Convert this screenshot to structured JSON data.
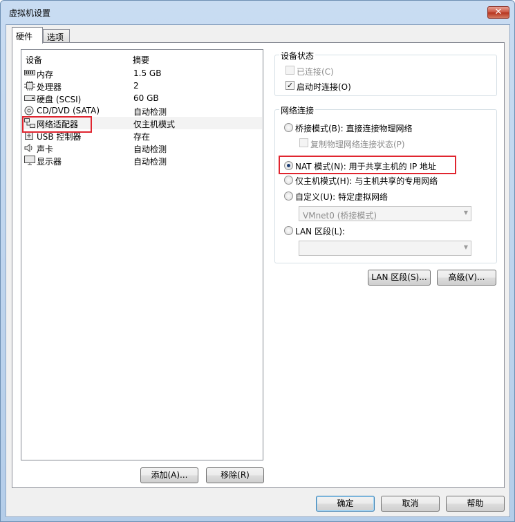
{
  "window": {
    "title": "虚拟机设置",
    "close_label": "✕"
  },
  "tabs": [
    {
      "label": "硬件"
    },
    {
      "label": "选项"
    }
  ],
  "device_list": {
    "columns": {
      "device": "设备",
      "summary": "摘要"
    },
    "rows": [
      {
        "name": "内存",
        "summary": "1.5 GB",
        "icon": "memory-icon"
      },
      {
        "name": "处理器",
        "summary": "2",
        "icon": "processor-icon"
      },
      {
        "name": "硬盘 (SCSI)",
        "summary": "60 GB",
        "icon": "hard-disk-icon"
      },
      {
        "name": "CD/DVD (SATA)",
        "summary": "自动检测",
        "icon": "cd-dvd-icon"
      },
      {
        "name": "网络适配器",
        "summary": "仅主机模式",
        "icon": "network-adapter-icon",
        "selected": true
      },
      {
        "name": "USB 控制器",
        "summary": "存在",
        "icon": "usb-icon"
      },
      {
        "name": "声卡",
        "summary": "自动检测",
        "icon": "sound-card-icon"
      },
      {
        "name": "显示器",
        "summary": "自动检测",
        "icon": "display-icon"
      }
    ],
    "add_label": "添加(A)...",
    "remove_label": "移除(R)"
  },
  "device_status": {
    "title": "设备状态",
    "connected": {
      "label": "已连接(C)",
      "checked": false,
      "enabled": false
    },
    "connect_at_power_on": {
      "label": "启动时连接(O)",
      "checked": true
    }
  },
  "network": {
    "title": "网络连接",
    "bridged": {
      "label": "桥接模式(B): 直接连接物理网络",
      "selected": false
    },
    "replicate": {
      "label": "复制物理网络连接状态(P)",
      "checked": false,
      "enabled": false
    },
    "nat": {
      "label": "NAT 模式(N): 用于共享主机的 IP 地址",
      "selected": true
    },
    "host_only": {
      "label": "仅主机模式(H): 与主机共享的专用网络",
      "selected": false
    },
    "custom": {
      "label": "自定义(U): 特定虚拟网络",
      "selected": false,
      "value": "VMnet0 (桥接模式)"
    },
    "lan_segment": {
      "label": "LAN 区段(L):",
      "selected": false,
      "value": ""
    },
    "lan_segments_button": "LAN 区段(S)...",
    "advanced_button": "高级(V)..."
  },
  "footer": {
    "ok": "确定",
    "cancel": "取消",
    "help": "帮助"
  }
}
